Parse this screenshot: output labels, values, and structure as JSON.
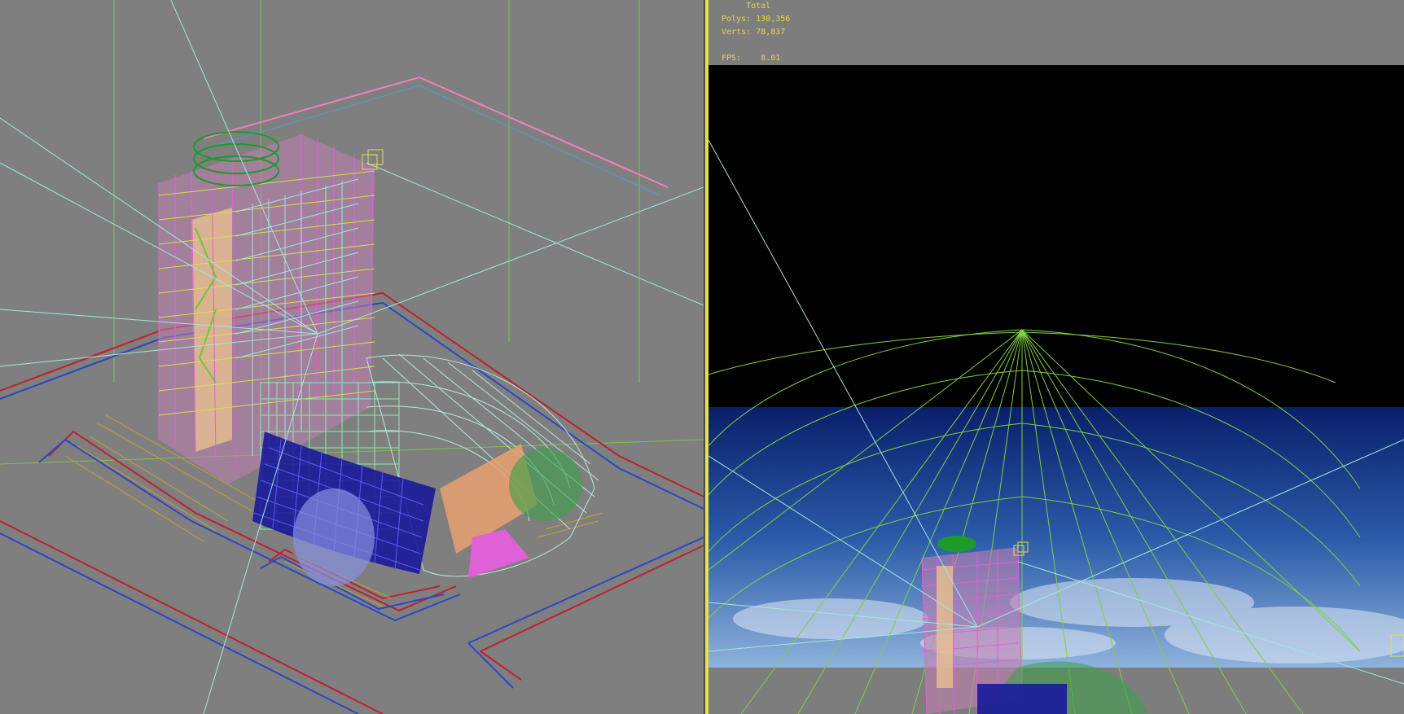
{
  "stats": {
    "header": "Total",
    "polys_label": "Polys:",
    "polys_value": "130,356",
    "verts_label": "Verts:",
    "verts_value": "78,837",
    "fps_label": "FPS:",
    "fps_value": "8.01"
  },
  "colors": {
    "viewport_bg": "#7f7f7f",
    "active_border": "#e6e24a",
    "stats_text": "#e8d84a",
    "sky_top": "#0a1f6b",
    "sky_bottom": "#7ea6d6",
    "wire_green": "#6fc63a",
    "wire_pink": "#e060d8",
    "wire_cyan": "#9fe8e0",
    "wire_red": "#c0202c",
    "wire_blue": "#2848c8"
  },
  "icons": {
    "camera_gizmo": "yellow-wireframe-box-icon"
  }
}
